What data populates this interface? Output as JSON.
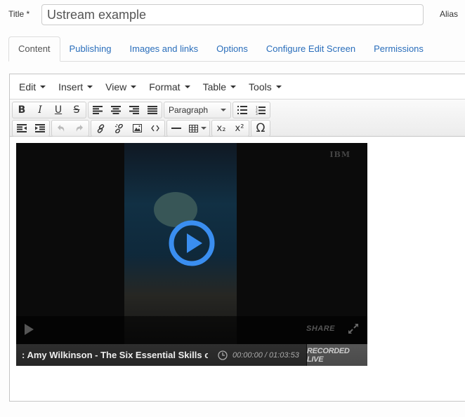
{
  "form": {
    "title_label": "Title *",
    "title_value": "Ustream example",
    "alias_label": "Alias"
  },
  "tabs": [
    {
      "label": "Content",
      "active": true
    },
    {
      "label": "Publishing",
      "active": false
    },
    {
      "label": "Images and links",
      "active": false
    },
    {
      "label": "Options",
      "active": false
    },
    {
      "label": "Configure Edit Screen",
      "active": false
    },
    {
      "label": "Permissions",
      "active": false
    }
  ],
  "editor": {
    "menu": [
      "Edit",
      "Insert",
      "View",
      "Format",
      "Table",
      "Tools"
    ],
    "toolbar": {
      "bold": "B",
      "italic": "I",
      "underline": "U",
      "strikethrough": "S",
      "format_select": "Paragraph",
      "omega": "Ω",
      "subscript": "x₂",
      "superscript": "x²"
    }
  },
  "video": {
    "brand": "IBM",
    "share_label": "SHARE",
    "title": ": Amy Wilkinson - The Six Essential Skills o",
    "time": "00:00:00 / 01:03:53",
    "badge": "RECORDED LIVE",
    "accent": "#3a8ef0"
  }
}
